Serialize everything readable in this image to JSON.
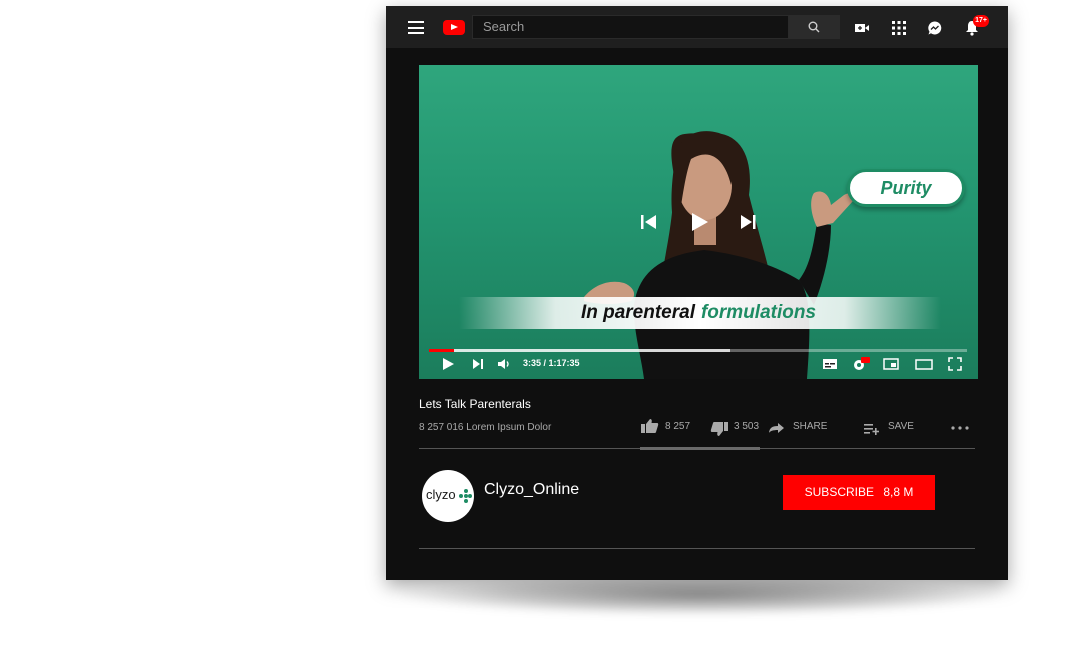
{
  "search": {
    "placeholder": "Search"
  },
  "notifications": {
    "badge": "17+"
  },
  "video": {
    "callout": "Purity",
    "lower_third_black": "In parenteral",
    "lower_third_green": "formulations",
    "time": "3:35 / 1:17:35",
    "progress_played": 0.046,
    "progress_buffered": 0.56
  },
  "info": {
    "title": "Lets Talk Parenterals",
    "views": "8 257 016 Lorem Ipsum Dolor",
    "likes": "8 257",
    "dislikes": "3 503",
    "share": "SHARE",
    "save": "SAVE"
  },
  "channel": {
    "avatar_text": "clyzo",
    "name": "Clyzo_Online",
    "subscribe_label": "SUBSCRIBE",
    "subscriber_count": "8,8 M"
  },
  "colors": {
    "accent": "#ff0000",
    "brand_green": "#1e8c64",
    "background": "#0f0f0f"
  }
}
